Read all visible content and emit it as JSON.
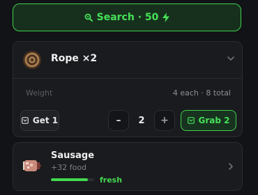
{
  "search": {
    "label": "Search · 50",
    "cost": 50
  },
  "items": [
    {
      "name": "Rope ×2",
      "weight_label": "Weight",
      "weight_value": "4 each · 8 total",
      "get_label": "Get 1",
      "quantity": "2",
      "grab_label": "Grab 2",
      "icon": "rope-icon"
    },
    {
      "name": "Sausage",
      "effect": "+32 food",
      "freshness_label": "fresh",
      "freshness": 0.85,
      "icon": "sausage-icon"
    }
  ],
  "colors": {
    "accent": "#46e058",
    "background": "#121316",
    "card": "#1a1b1f"
  }
}
